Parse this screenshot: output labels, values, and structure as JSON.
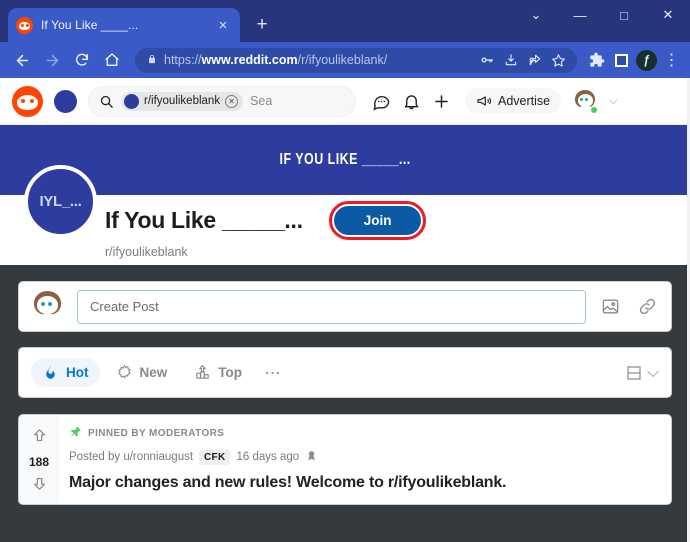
{
  "browser": {
    "tab": {
      "title": "If You Like ____...",
      "favicon": "reddit-icon",
      "close": "×"
    },
    "new_tab": "+",
    "window_controls": {
      "tab_search": "⌄",
      "minimize": "—",
      "maximize": "□",
      "close": "✕"
    },
    "nav": {
      "back": "←",
      "forward": "→",
      "reload": "↻",
      "home": "⌂"
    },
    "omnibox": {
      "lock": "🔒",
      "url_prefix": "https://",
      "url_domain": "www.reddit.com",
      "url_path": "/r/ifyoulikeblank/",
      "icons": [
        "key-icon",
        "install-icon",
        "share-icon",
        "bookmark-star-icon"
      ]
    },
    "extensions": {
      "puzzle": "puzzle-icon",
      "square": "square-extension-icon",
      "circle_letter": "ƒ",
      "menu": "⋮"
    }
  },
  "reddit": {
    "logo": "reddit-logo",
    "search": {
      "chip_label": "r/ifyoulikeblank",
      "chip_remove": "✕",
      "placeholder": "Sea"
    },
    "header_icons": [
      "chat-icon",
      "notifications-bell-icon",
      "create-plus-icon"
    ],
    "advertise": {
      "label": "Advertise",
      "icon": "megaphone-icon"
    },
    "user": {
      "avatar": "user-avatar-snoo",
      "online": true,
      "caret": "⌵"
    }
  },
  "subreddit": {
    "banner_text": "IF YOU LIKE _____...",
    "avatar_text": "IYL_...",
    "title": "If You Like _____...",
    "handle": "r/ifyoulikeblank",
    "join_label": "Join",
    "join_highlight_color": "#ed1c24",
    "join_bg_color": "#0c5aa6"
  },
  "create_post": {
    "placeholder": "Create Post",
    "image_icon": "image-icon",
    "link_icon": "link-icon"
  },
  "sort_bar": {
    "items": [
      {
        "label": "Hot",
        "icon": "flame-icon",
        "active": true
      },
      {
        "label": "New",
        "icon": "starburst-icon",
        "active": false
      },
      {
        "label": "Top",
        "icon": "podium-icon",
        "active": false
      }
    ],
    "more": "⋯",
    "view_icon": "card-view-icon",
    "view_caret": "⌵"
  },
  "post": {
    "pinned_label": "PINNED BY MODERATORS",
    "pin_icon": "📌",
    "posted_by": "Posted by u/ronniaugust",
    "flair": "CFK",
    "timestamp": "16 days ago",
    "award_icon": "award-icon",
    "title": "Major changes and new rules! Welcome to r/ifyoulikeblank.",
    "score": "188",
    "upvote": "upvote-arrow-icon",
    "downvote": "downvote-arrow-icon"
  }
}
